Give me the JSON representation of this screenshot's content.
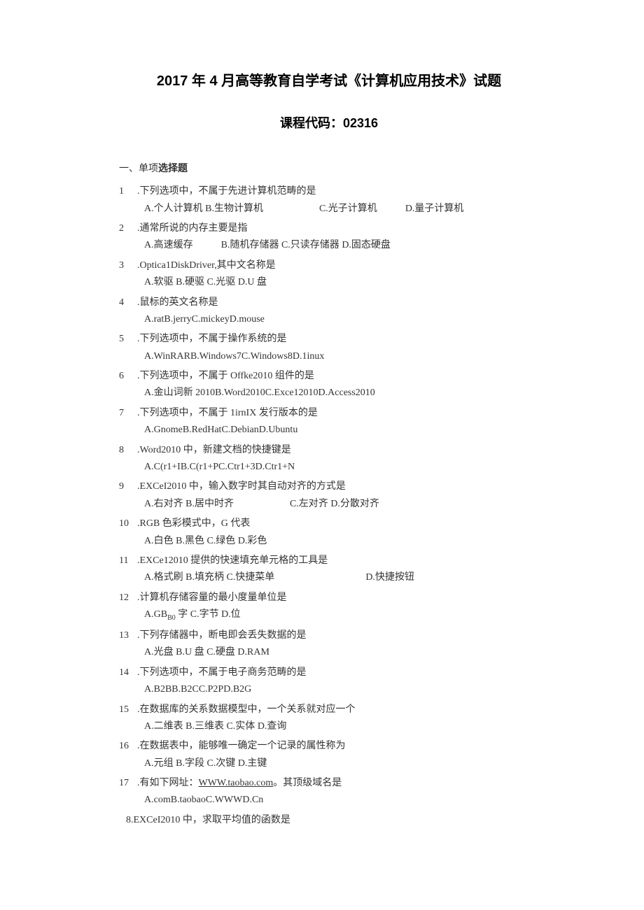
{
  "title": "2017 年 4 月高等教育自学考试《计算机应用技术》试题",
  "subtitle": "课程代码：02316",
  "sectionHeader": {
    "prefix": "一、单项",
    "bold": "选择题"
  },
  "questions": [
    {
      "num": "1",
      "text": ".下列选项中，不属于先进计算机范畴的是",
      "opts": [
        "A.个人计算机",
        "B.生物计算机",
        "C.光子计算机",
        "D.量子计算机"
      ],
      "layout": "q1"
    },
    {
      "num": "2",
      "text": ".通常所说的内存主要是指",
      "opts": [
        "A.高速缓存",
        "B.随机存储器",
        "C.只读存储器",
        "D.固态硬盘"
      ],
      "layout": "q2"
    },
    {
      "num": "3",
      "text": ".Optica1DiskDriver,其中文名称是",
      "opts": [
        "A.软驱",
        "B.硬驱",
        "C.光驱",
        "D.U 盘"
      ],
      "layout": "compact"
    },
    {
      "num": "4",
      "text": ".鼠标的英文名称是",
      "opts": [
        "A.rat",
        "B.jerry",
        "C.mickey",
        "D.mouse"
      ],
      "layout": "compact-nospace"
    },
    {
      "num": "5",
      "text": ".下列选项中，不属于操作系统的是",
      "opts": [
        "A.WinRAR",
        "B.Windows7",
        "C.Windows8",
        "D.1inux"
      ],
      "layout": "compact-nospace"
    },
    {
      "num": "6",
      "text": ".下列选项中，不属于 Offke2010 组件的是",
      "opts": [
        "A.金山词新 2010",
        "B.Word2010",
        "C.Exce12010",
        "D.Access2010"
      ],
      "layout": "compact-nospace"
    },
    {
      "num": "7",
      "text": ".下列选项中，不属于 1irnIX 发行版本的是",
      "opts": [
        "A.Gnome",
        "B.RedHat",
        "C.Debian",
        "D.Ubuntu"
      ],
      "layout": "compact-nospace"
    },
    {
      "num": "8",
      "text": ".Word2010 中，新建文档的快捷键是",
      "opts": [
        "A.C(r1+I",
        "B.C(r1+P",
        "C.Ctr1+3",
        "D.Ctr1+N"
      ],
      "layout": "compact-nospace"
    },
    {
      "num": "9",
      "text": ".EXCeI2010 中，输入数字时其自动对齐的方式是",
      "opts": [
        "A.右对齐",
        "B.居中时齐",
        "C.左对齐",
        "D.分散对齐"
      ],
      "layout": "q9"
    },
    {
      "num": "10",
      "text": ".RGB 色彩模式中，G 代表",
      "opts": [
        "A.白色",
        "B.黑色",
        "C.绿色",
        "D.彩色"
      ],
      "layout": "compact"
    },
    {
      "num": "11",
      "text": ".EXCe12010 提供的快速填充单元格的工具是",
      "opts": [
        "A.格式刷",
        "B.填充柄",
        "C.快捷菜单",
        "D.快捷按钮"
      ],
      "layout": "q11"
    },
    {
      "num": "12",
      "text": ".计算机存储容量的最小度量单位是",
      "opts_html": "A.GB<span class=\"sub\">B0</span> 字 C.字节 D.位",
      "layout": "html"
    },
    {
      "num": "13",
      "text": ".下列存储器中，断电即会丢失数据的是",
      "opts": [
        "A.光盘",
        "B.U 盘",
        "C.硬盘",
        "D.RAM"
      ],
      "layout": "compact"
    },
    {
      "num": "14",
      "text": ".下列选项中，不属于电子商务范畴的是",
      "opts": [
        "A.B2B",
        "B.B2C",
        "C.P2P",
        "D.B2G"
      ],
      "layout": "compact-nospace"
    },
    {
      "num": "15",
      "text": ".在数据库的关系数据模型中，一个关系就对应一个",
      "opts": [
        "A.二维表",
        "B.三维表",
        "C.实体",
        "D.查询"
      ],
      "layout": "compact"
    },
    {
      "num": "16",
      "text": ".在数据表中，能够唯一确定一个记录的属性称为",
      "opts": [
        "A.元组",
        "B.字段",
        "C.次键",
        "D.主键"
      ],
      "layout": "compact"
    },
    {
      "num": "17",
      "text_html": ".有如下网址：<span class=\"underline\">WWW.taobao.com</span>。其顶级域名是",
      "opts": [
        "A.com",
        "B.taobao",
        "C.WWW",
        "D.Cn"
      ],
      "layout": "compact-nospace"
    }
  ],
  "lastQuestion": "8.EXCeI2010 中，求取平均值的函数是"
}
